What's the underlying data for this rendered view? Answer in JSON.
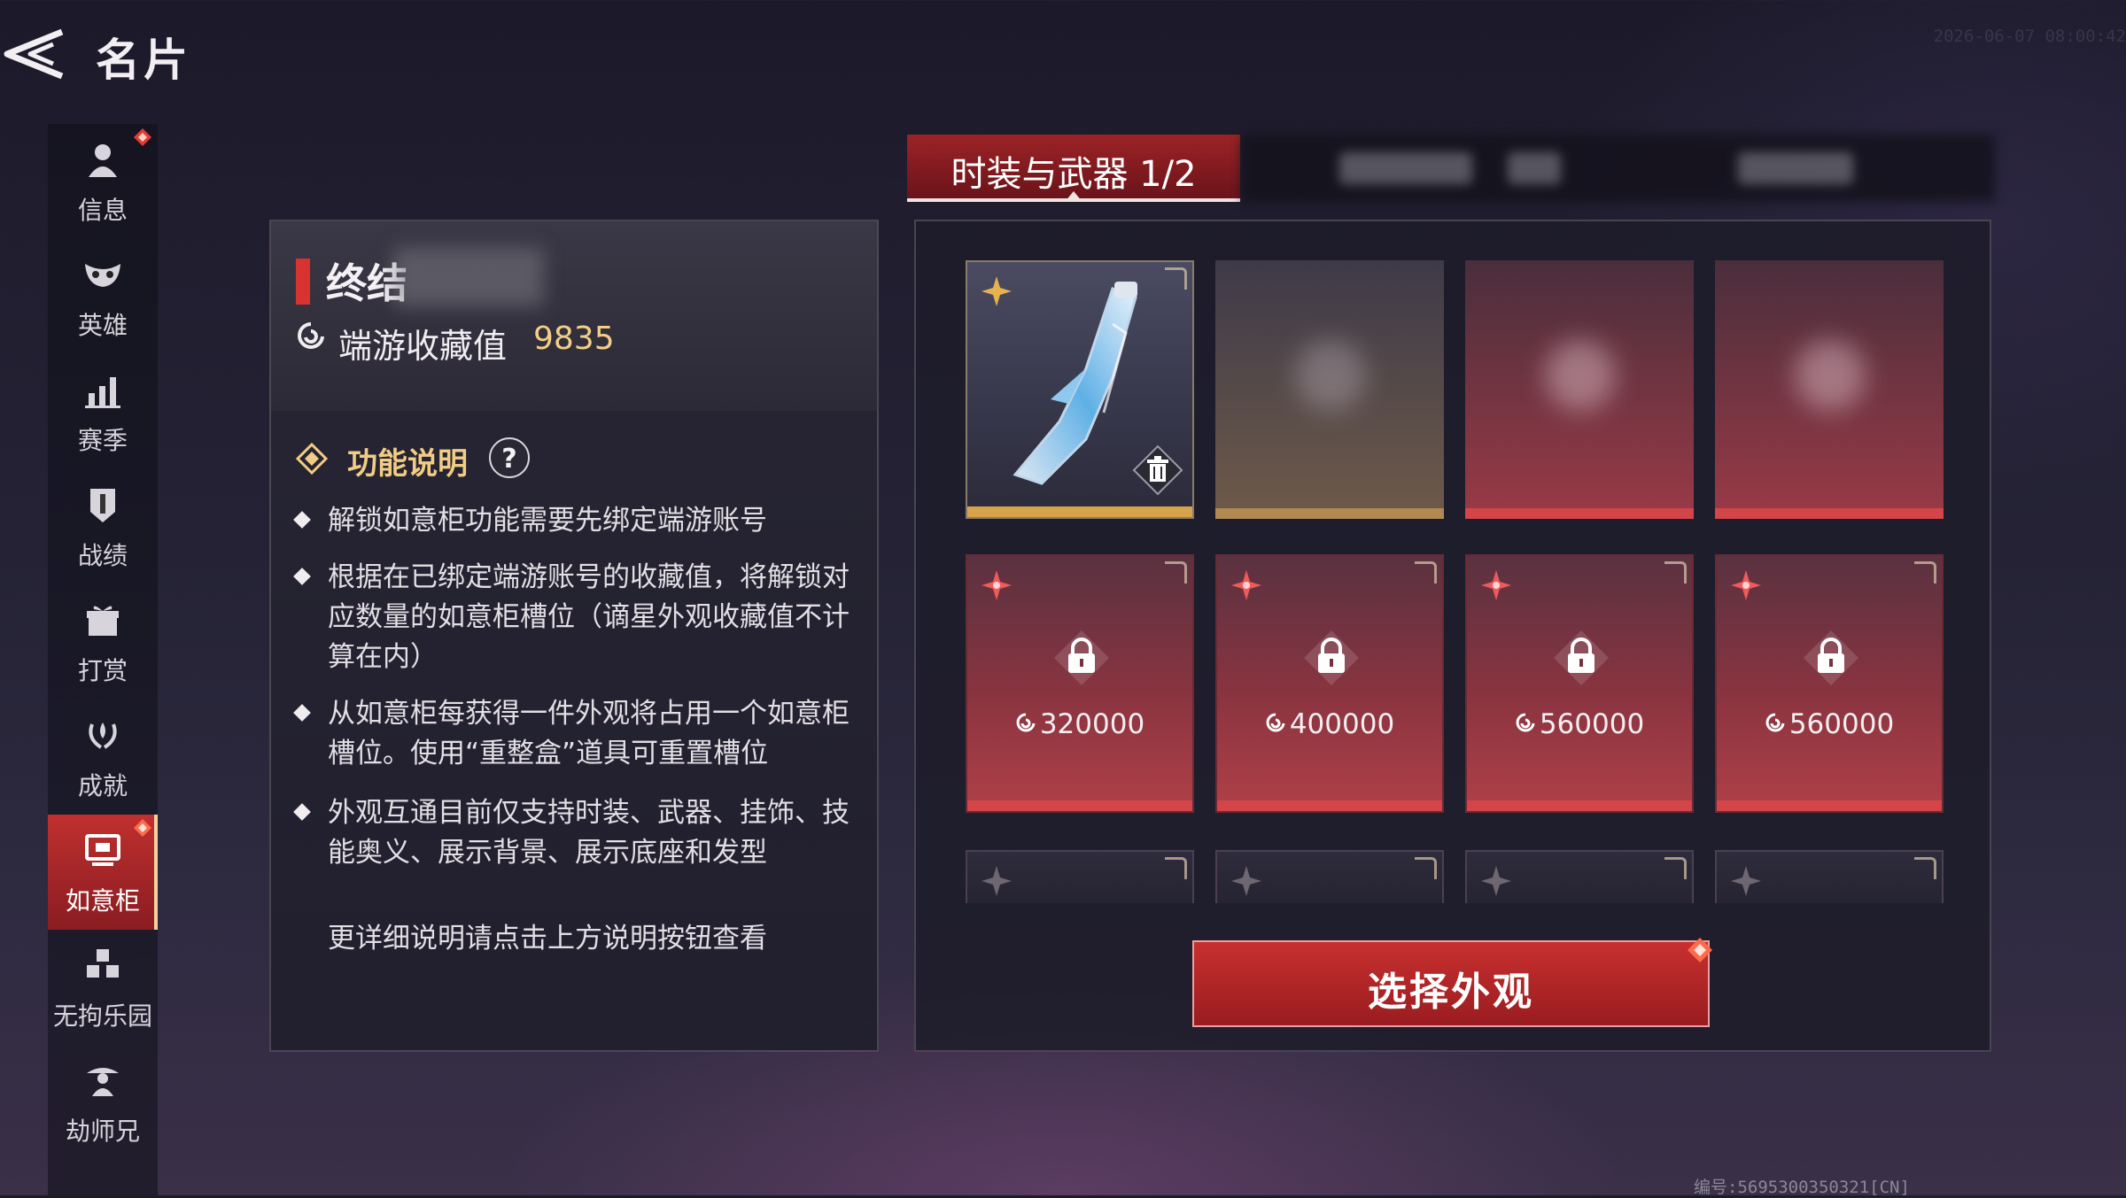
{
  "header": {
    "title": "名片",
    "timestamp": "2026-06-07 08:00:42"
  },
  "footer": {
    "player_id": "编号:5695300350321[CN]"
  },
  "sidebar": {
    "items": [
      {
        "label": "信息",
        "icon": "person-icon",
        "badge": true
      },
      {
        "label": "英雄",
        "icon": "mask-icon"
      },
      {
        "label": "赛季",
        "icon": "bar-chart-icon"
      },
      {
        "label": "战绩",
        "icon": "shield-icon"
      },
      {
        "label": "打赏",
        "icon": "gift-icon"
      },
      {
        "label": "成就",
        "icon": "laurel-icon"
      },
      {
        "label": "如意柜",
        "icon": "cabinet-icon",
        "active": true,
        "badge": true
      },
      {
        "label": "无拘乐园",
        "icon": "cubes-icon"
      },
      {
        "label": "劫师兄",
        "icon": "figure-icon"
      }
    ]
  },
  "profile": {
    "name": "终结",
    "collection_label": "端游收藏值",
    "collection_value": "9835"
  },
  "help": {
    "title": "功能说明",
    "button": "?",
    "items": [
      "解锁如意柜功能需要先绑定端游账号",
      "根据在已绑定端游账号的收藏值，将解锁对应数量的如意柜槽位（谪星外观收藏值不计算在内）",
      "从如意柜每获得一件外观将占用一个如意柜槽位。使用“重整盒”道具可重置槽位",
      "外观互通目前仅支持时装、武器、挂饰、技能奥义、展示背景、展示底座和发型"
    ],
    "footer": "更详细说明请点击上方说明按钮查看"
  },
  "tab": {
    "label": "时装与武器 1/2"
  },
  "slots": {
    "locked": [
      {
        "price": "320000"
      },
      {
        "price": "400000"
      },
      {
        "price": "560000"
      },
      {
        "price": "560000"
      }
    ]
  },
  "select_button": {
    "label": "选择外观"
  },
  "colors": {
    "accent_red": "#c8302e",
    "gold": "#f3cf86",
    "panel": "#2a2838"
  }
}
